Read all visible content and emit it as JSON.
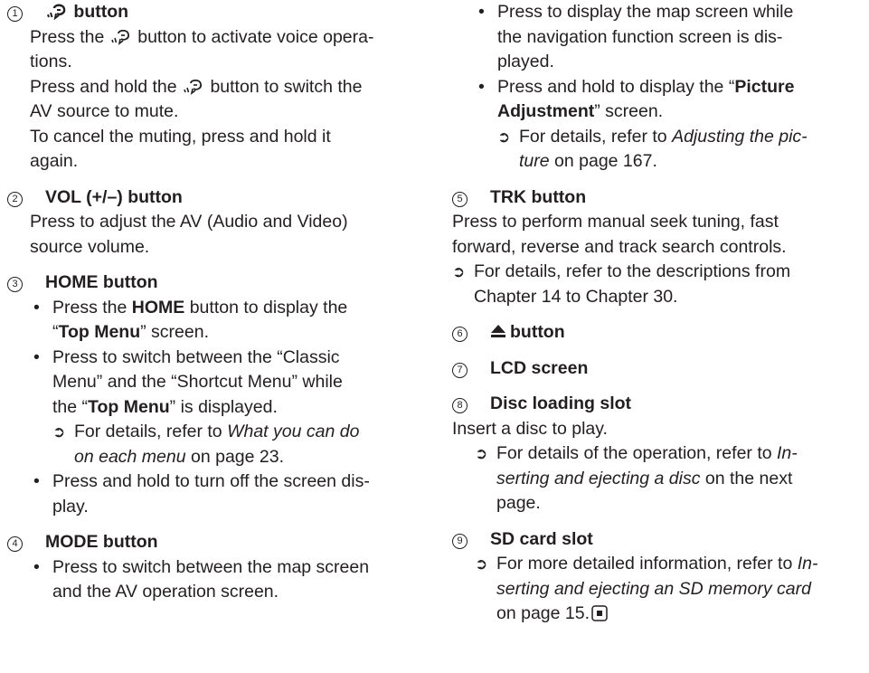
{
  "left": {
    "s1": {
      "num": "1",
      "title": "button",
      "p1_pre": "Press the",
      "p1_post": "button to activate voice opera-",
      "p1_cont": "tions.",
      "p2_pre": "Press and hold the",
      "p2_post": "button to switch the",
      "p2_cont": "AV source to mute.",
      "p3a": "To cancel the muting, press and hold it",
      "p3b": "again."
    },
    "s2": {
      "num": "2",
      "title": "VOL (+/–) button",
      "p1a": "Press to adjust the AV (Audio and Video)",
      "p1b": "source volume."
    },
    "s3": {
      "num": "3",
      "title": "HOME button",
      "b1_pre": "Press the ",
      "b1_bold": "HOME",
      "b1_post": " button to display the",
      "b1_l2_q1": "“",
      "b1_l2_bold": "Top Menu",
      "b1_l2_post": "” screen.",
      "b2_l1": "Press to switch between the “Classic",
      "b2_l2": "Menu” and the “Shortcut Menu” while",
      "b2_l3_pre": "the “",
      "b2_l3_bold": "Top Menu",
      "b2_l3_post": "” is displayed.",
      "ref_pre": "For details, refer to ",
      "ref_it1": "What you can do",
      "ref_it2": "on each menu",
      "ref_post": " on page 23.",
      "b3_l1": "Press and hold to turn off the screen dis-",
      "b3_l2": "play."
    },
    "s4": {
      "num": "4",
      "title": "MODE button",
      "b1_l1": "Press to switch between the map screen",
      "b1_l2": "and the AV operation screen."
    }
  },
  "right": {
    "cont": {
      "b1_l1": "Press to display the map screen while",
      "b1_l2": "the navigation function screen is dis-",
      "b1_l3": "played.",
      "b2_l1_pre": "Press and hold to display the “",
      "b2_l1_bold": "Picture",
      "b2_l2_bold": "Adjustment",
      "b2_l2_post": "” screen.",
      "ref_pre": "For details, refer to ",
      "ref_it1": "Adjusting the pic-",
      "ref_it2": "ture",
      "ref_post": " on page 167."
    },
    "s5": {
      "num": "5",
      "title": "TRK button",
      "p1a": "Press to perform manual seek tuning, fast",
      "p1b": "forward, reverse and track search controls.",
      "ref_l1": "For details, refer to the descriptions from",
      "ref_l2": "Chapter 14 to Chapter 30."
    },
    "s6": {
      "num": "6",
      "title": "button"
    },
    "s7": {
      "num": "7",
      "title": "LCD screen"
    },
    "s8": {
      "num": "8",
      "title": "Disc loading slot",
      "p1": "Insert a disc to play.",
      "ref_pre": "For details of the operation, refer to ",
      "ref_it1": "In-",
      "ref_it2": "serting and ejecting a disc",
      "ref_post2": " on the next",
      "ref_l3": "page."
    },
    "s9": {
      "num": "9",
      "title": "SD card slot",
      "ref_pre": "For more detailed information, refer to ",
      "ref_it1": "In-",
      "ref_it2": "serting and ejecting an SD memory card",
      "ref_l3": "on page 15."
    }
  },
  "glyphs": {
    "bullet": "•",
    "arrow": "➲"
  }
}
